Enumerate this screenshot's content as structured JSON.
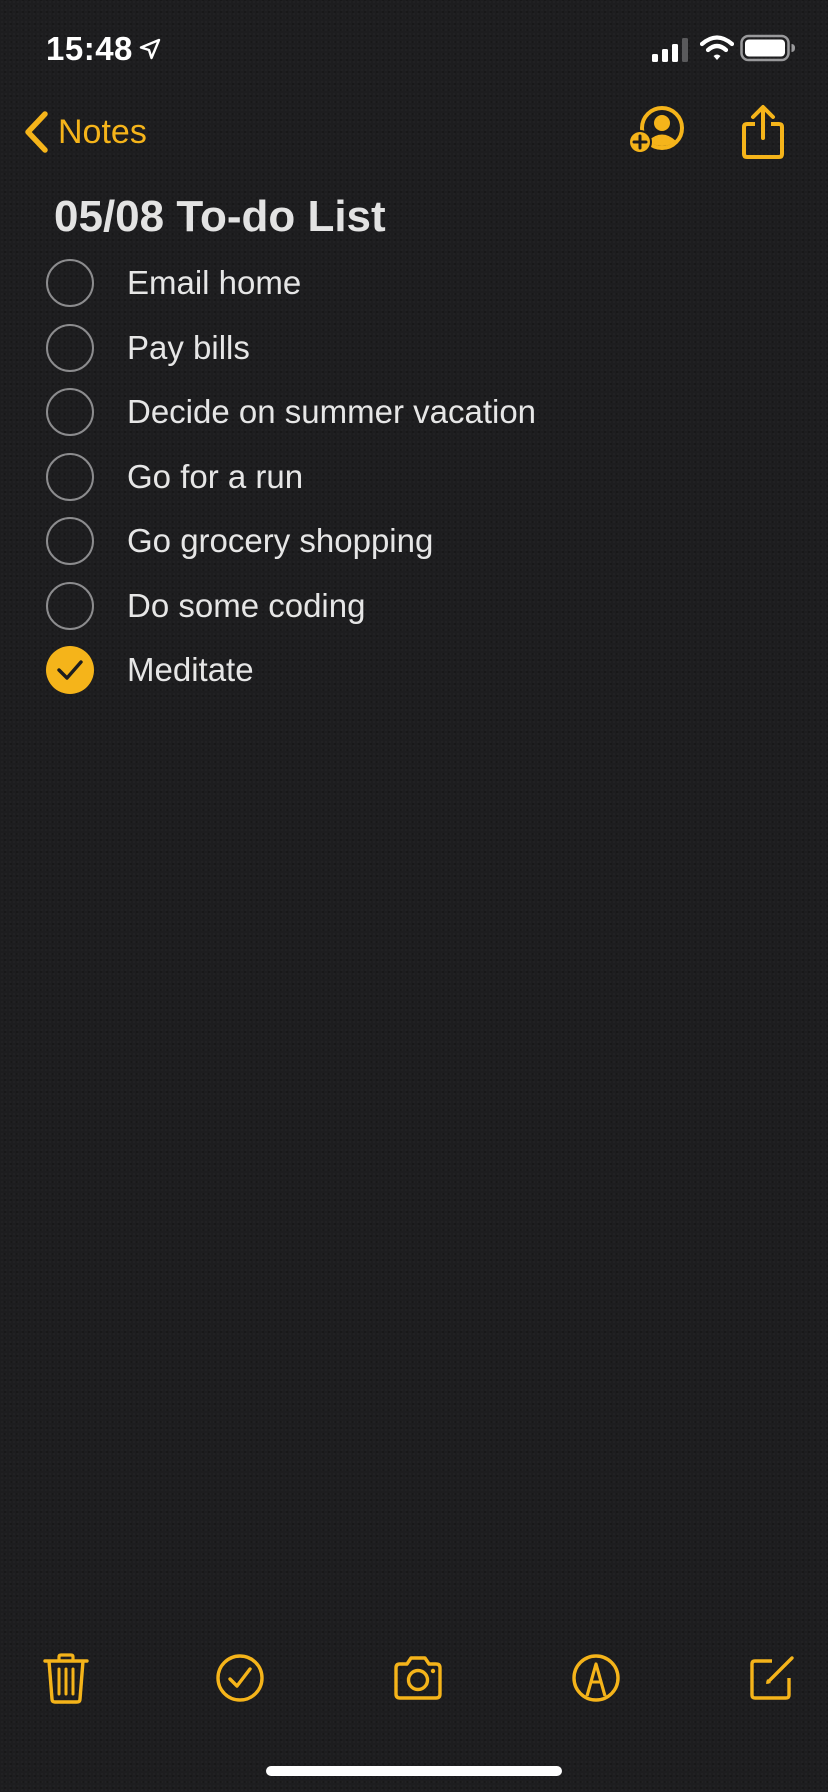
{
  "status_bar": {
    "time": "15:48",
    "icons": [
      "location-arrow-icon",
      "cellular-signal-icon",
      "wifi-icon",
      "battery-icon"
    ]
  },
  "nav": {
    "back_label": "Notes",
    "back_icon": "chevron-left-icon",
    "actions": [
      "add-people-icon",
      "share-icon"
    ]
  },
  "note": {
    "title": "05/08 To-do List",
    "items": [
      {
        "label": "Email home",
        "checked": false
      },
      {
        "label": "Pay bills",
        "checked": false
      },
      {
        "label": "Decide on summer vacation",
        "checked": false
      },
      {
        "label": "Go for a run",
        "checked": false
      },
      {
        "label": "Go grocery shopping",
        "checked": false
      },
      {
        "label": "Do some coding",
        "checked": false
      },
      {
        "label": "Meditate",
        "checked": true
      }
    ]
  },
  "toolbar": {
    "buttons": [
      "trash-icon",
      "checklist-icon",
      "camera-icon",
      "markup-icon",
      "compose-icon"
    ]
  },
  "colors": {
    "accent": "#f5b41a",
    "background": "#1d1d1f",
    "text": "#e6e6e6",
    "unchecked_circle": "#8c8c8e"
  }
}
